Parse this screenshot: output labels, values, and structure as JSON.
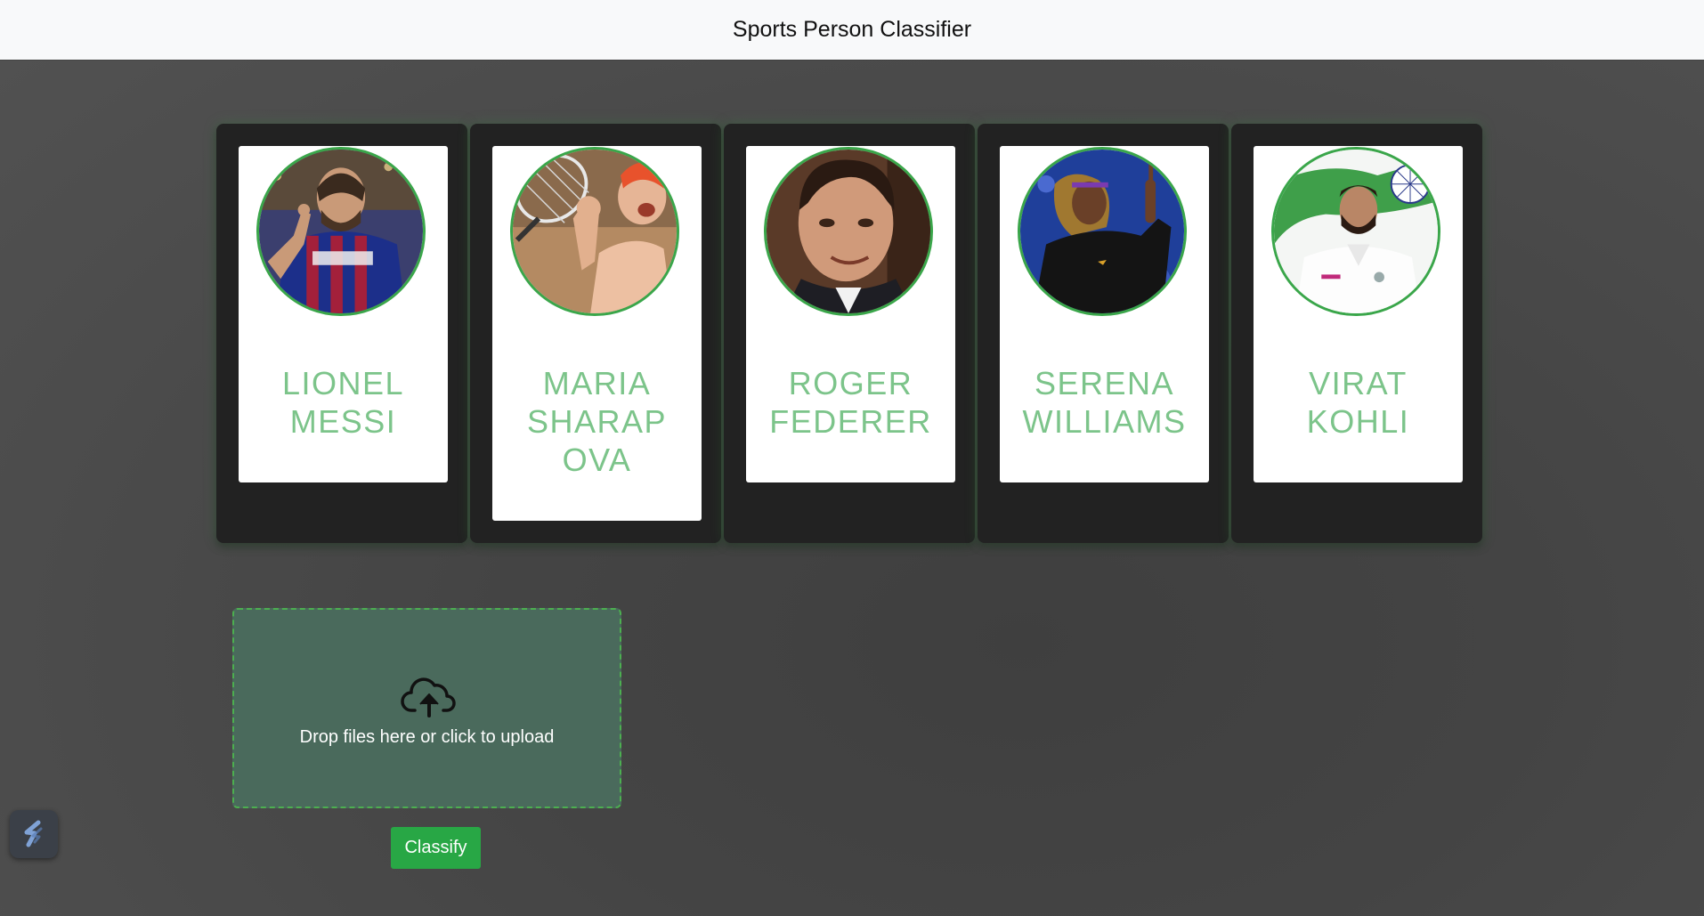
{
  "navbar": {
    "title": "Sports Person Classifier"
  },
  "players": [
    {
      "name_line1": "LIONEL",
      "name_line2": "MESSI",
      "name_line3": ""
    },
    {
      "name_line1": "MARIA",
      "name_line2": "SHARAP",
      "name_line3": "OVA"
    },
    {
      "name_line1": "ROGER",
      "name_line2": "FEDERER",
      "name_line3": ""
    },
    {
      "name_line1": "SERENA",
      "name_line2": "WILLIAMS",
      "name_line3": ""
    },
    {
      "name_line1": "VIRAT",
      "name_line2": "KOHLI",
      "name_line3": ""
    }
  ],
  "upload": {
    "prompt": "Drop files here or click to upload",
    "icon": "cloud-upload-icon"
  },
  "classify": {
    "label": "Classify"
  },
  "colors": {
    "accent_green": "#28a745",
    "name_green": "#7cc48a",
    "card_bg": "#222222",
    "navbar_bg": "#f8f9fa"
  }
}
